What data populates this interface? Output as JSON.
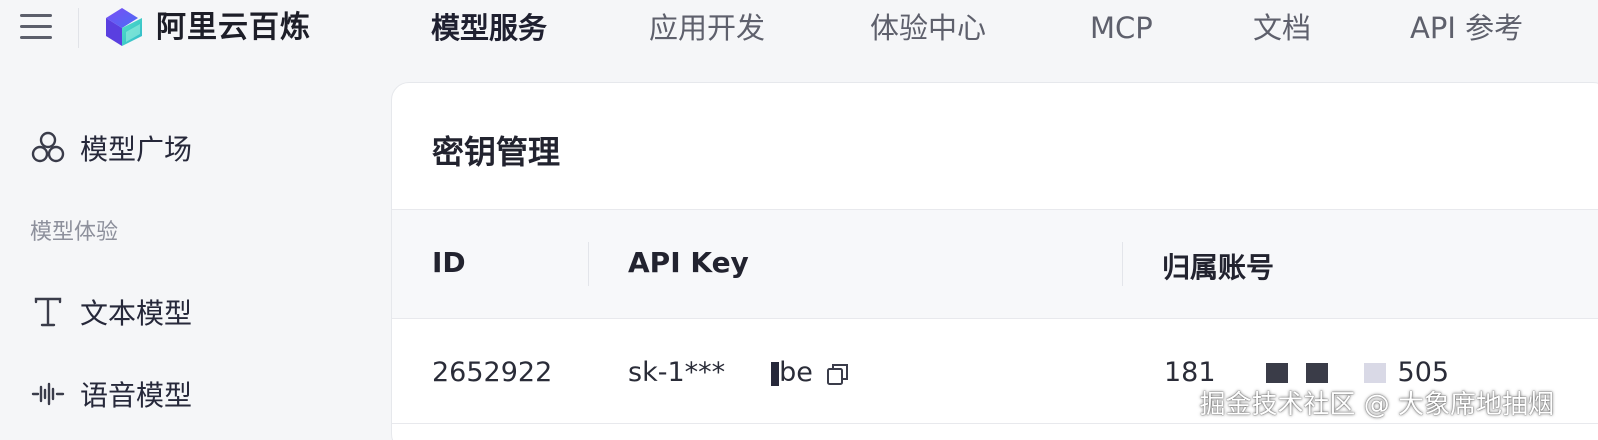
{
  "topbar": {
    "brand": "阿里云百炼",
    "nav": [
      {
        "label": "模型服务",
        "active": true
      },
      {
        "label": "应用开发",
        "active": false
      },
      {
        "label": "体验中心",
        "active": false
      },
      {
        "label": "MCP",
        "active": false
      },
      {
        "label": "文档",
        "active": false
      },
      {
        "label": "API 参考",
        "active": false
      }
    ]
  },
  "sidebar": {
    "model_square": {
      "label": "模型广场",
      "icon": "model-square-icon"
    },
    "section_label": "模型体验",
    "text_model": {
      "label": "文本模型",
      "icon": "text-t-icon"
    },
    "voice_model": {
      "label": "语音模型",
      "icon": "audio-wave-icon"
    }
  },
  "panel": {
    "title": "密钥管理",
    "columns": [
      "ID",
      "API Key",
      "归属账号"
    ],
    "row": {
      "id": "2652922",
      "api_key_prefix": "sk-1***",
      "api_key_suffix": "be",
      "account_prefix": "181",
      "account_suffix": "505"
    }
  },
  "watermark": "掘金技术社区 @ 大象席地抽烟",
  "colors": {
    "background": "#f5f6f8",
    "panel": "#ffffff",
    "text": "#26283a",
    "muted": "#8d909c",
    "logo_purple": "#6b4df0",
    "logo_teal": "#3fd2c7"
  }
}
